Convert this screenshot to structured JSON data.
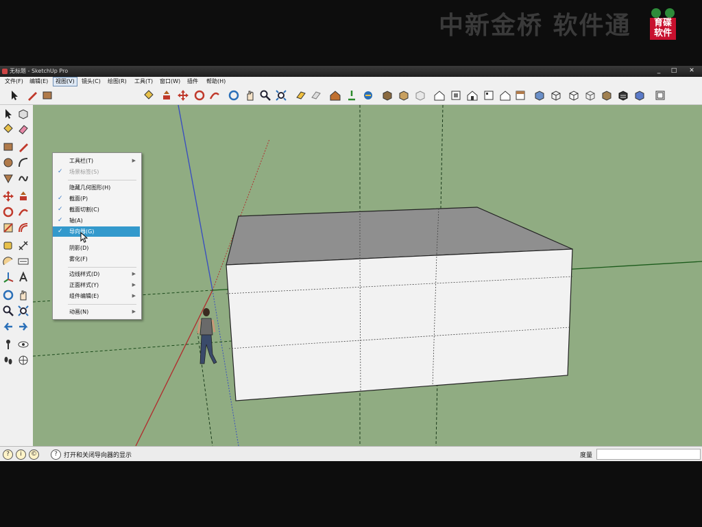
{
  "watermark": {
    "text": "中新金桥 软件通",
    "logo_text": "育碟软件"
  },
  "window": {
    "title": "无标题 - SketchUp Pro",
    "controls": [
      "_",
      "□",
      "✕"
    ]
  },
  "menubar": {
    "items": [
      "文件(F)",
      "编辑(E)",
      "视图(V)",
      "镜头(C)",
      "绘图(R)",
      "工具(T)",
      "窗口(W)",
      "插件",
      "帮助(H)"
    ]
  },
  "view_menu": {
    "items": [
      {
        "label": "工具栏(T)",
        "checked": false,
        "disabled": false,
        "submenu": true,
        "highlighted": false
      },
      {
        "label": "场景标签(S)",
        "checked": true,
        "disabled": true,
        "submenu": false,
        "highlighted": false
      },
      {
        "label": "隐藏几何图形(H)",
        "checked": false,
        "disabled": false,
        "submenu": false,
        "highlighted": false
      },
      {
        "label": "截面(P)",
        "checked": true,
        "disabled": false,
        "submenu": false,
        "highlighted": false
      },
      {
        "label": "截面切割(C)",
        "checked": true,
        "disabled": false,
        "submenu": false,
        "highlighted": false
      },
      {
        "label": "轴(A)",
        "checked": true,
        "disabled": false,
        "submenu": false,
        "highlighted": false
      },
      {
        "label": "导向器(G)",
        "checked": true,
        "disabled": false,
        "submenu": false,
        "highlighted": true
      },
      {
        "label": "阴影(D)",
        "checked": false,
        "disabled": false,
        "submenu": false,
        "highlighted": false
      },
      {
        "label": "雾化(F)",
        "checked": false,
        "disabled": false,
        "submenu": false,
        "highlighted": false
      },
      {
        "label": "边线样式(D)",
        "checked": false,
        "disabled": false,
        "submenu": true,
        "highlighted": false
      },
      {
        "label": "正面样式(Y)",
        "checked": false,
        "disabled": false,
        "submenu": true,
        "highlighted": false
      },
      {
        "label": "组件编辑(E)",
        "checked": false,
        "disabled": false,
        "submenu": true,
        "highlighted": false
      },
      {
        "label": "动画(N)",
        "checked": false,
        "disabled": false,
        "submenu": true,
        "highlighted": false
      }
    ]
  },
  "status": {
    "message": "打开和关闭导向器的显示",
    "measure_label": "度量",
    "measure_value": ""
  },
  "colors": {
    "viewport_bg": "#90ac82",
    "highlight": "#3399cc",
    "box_top": "#8f8f8f",
    "box_face": "#f2f2f2"
  }
}
